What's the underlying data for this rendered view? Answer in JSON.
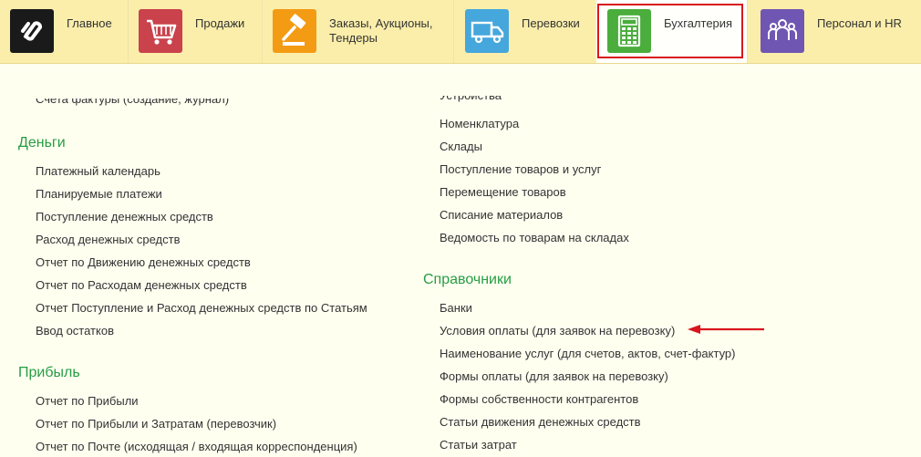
{
  "nav": {
    "items": [
      {
        "id": "home",
        "label": "Главное",
        "icon": "logo-icon",
        "color": "#1a1a1a"
      },
      {
        "id": "sales",
        "label": "Продажи",
        "icon": "cart-icon",
        "color": "#c9424c"
      },
      {
        "id": "orders",
        "label": "Заказы,  Аукционы,",
        "label2": "Тендеры",
        "icon": "gavel-icon",
        "color": "#f49b14"
      },
      {
        "id": "transport",
        "label": "Перевозки",
        "icon": "truck-icon",
        "color": "#45a7dc"
      },
      {
        "id": "accounting",
        "label": "Бухгалтерия",
        "icon": "calculator-icon",
        "color": "#4aad3c",
        "active": true
      },
      {
        "id": "hr",
        "label": "Персонал и HR",
        "icon": "people-icon",
        "color": "#6f56b3"
      }
    ],
    "highlight_color": "#d9151e"
  },
  "left": {
    "cut_link": "Счета фактуры (создание, журнал)",
    "sections": [
      {
        "title": "Деньги",
        "links": [
          "Платежный календарь",
          "Планируемые платежи",
          "Поступление денежных средств",
          "Расход денежных средств",
          "Отчет по Движению денежных средств",
          "Отчет по Расходам денежных средств",
          "Отчет Поступление и Расход денежных средств по Статьям",
          "Ввод остатков"
        ]
      },
      {
        "title": "Прибыль",
        "links": [
          "Отчет по Прибыли",
          "Отчет по Прибыли и Затратам (перевозчик)",
          "Отчет по Почте (исходящая / входящая корреспонденция)"
        ]
      }
    ]
  },
  "right": {
    "cut_link": "Устройства",
    "group_links": [
      "Номенклатура",
      "Склады",
      "Поступление товаров и услуг",
      "Перемещение товаров",
      "Списание материалов",
      "Ведомость по товарам на складах"
    ],
    "sections": [
      {
        "title": "Справочники",
        "links": [
          "Банки",
          "Условия оплаты (для заявок на перевозку)",
          "Наименование услуг (для счетов, актов, счет-фактур)",
          "Формы оплаты (для заявок на перевозку)",
          "Формы собственности контрагентов",
          "Статьи движения денежных средств",
          "Статьи затрат"
        ]
      }
    ]
  },
  "colors": {
    "section_title": "#279d44",
    "link": "#333333",
    "arrow": "#d9151e"
  }
}
